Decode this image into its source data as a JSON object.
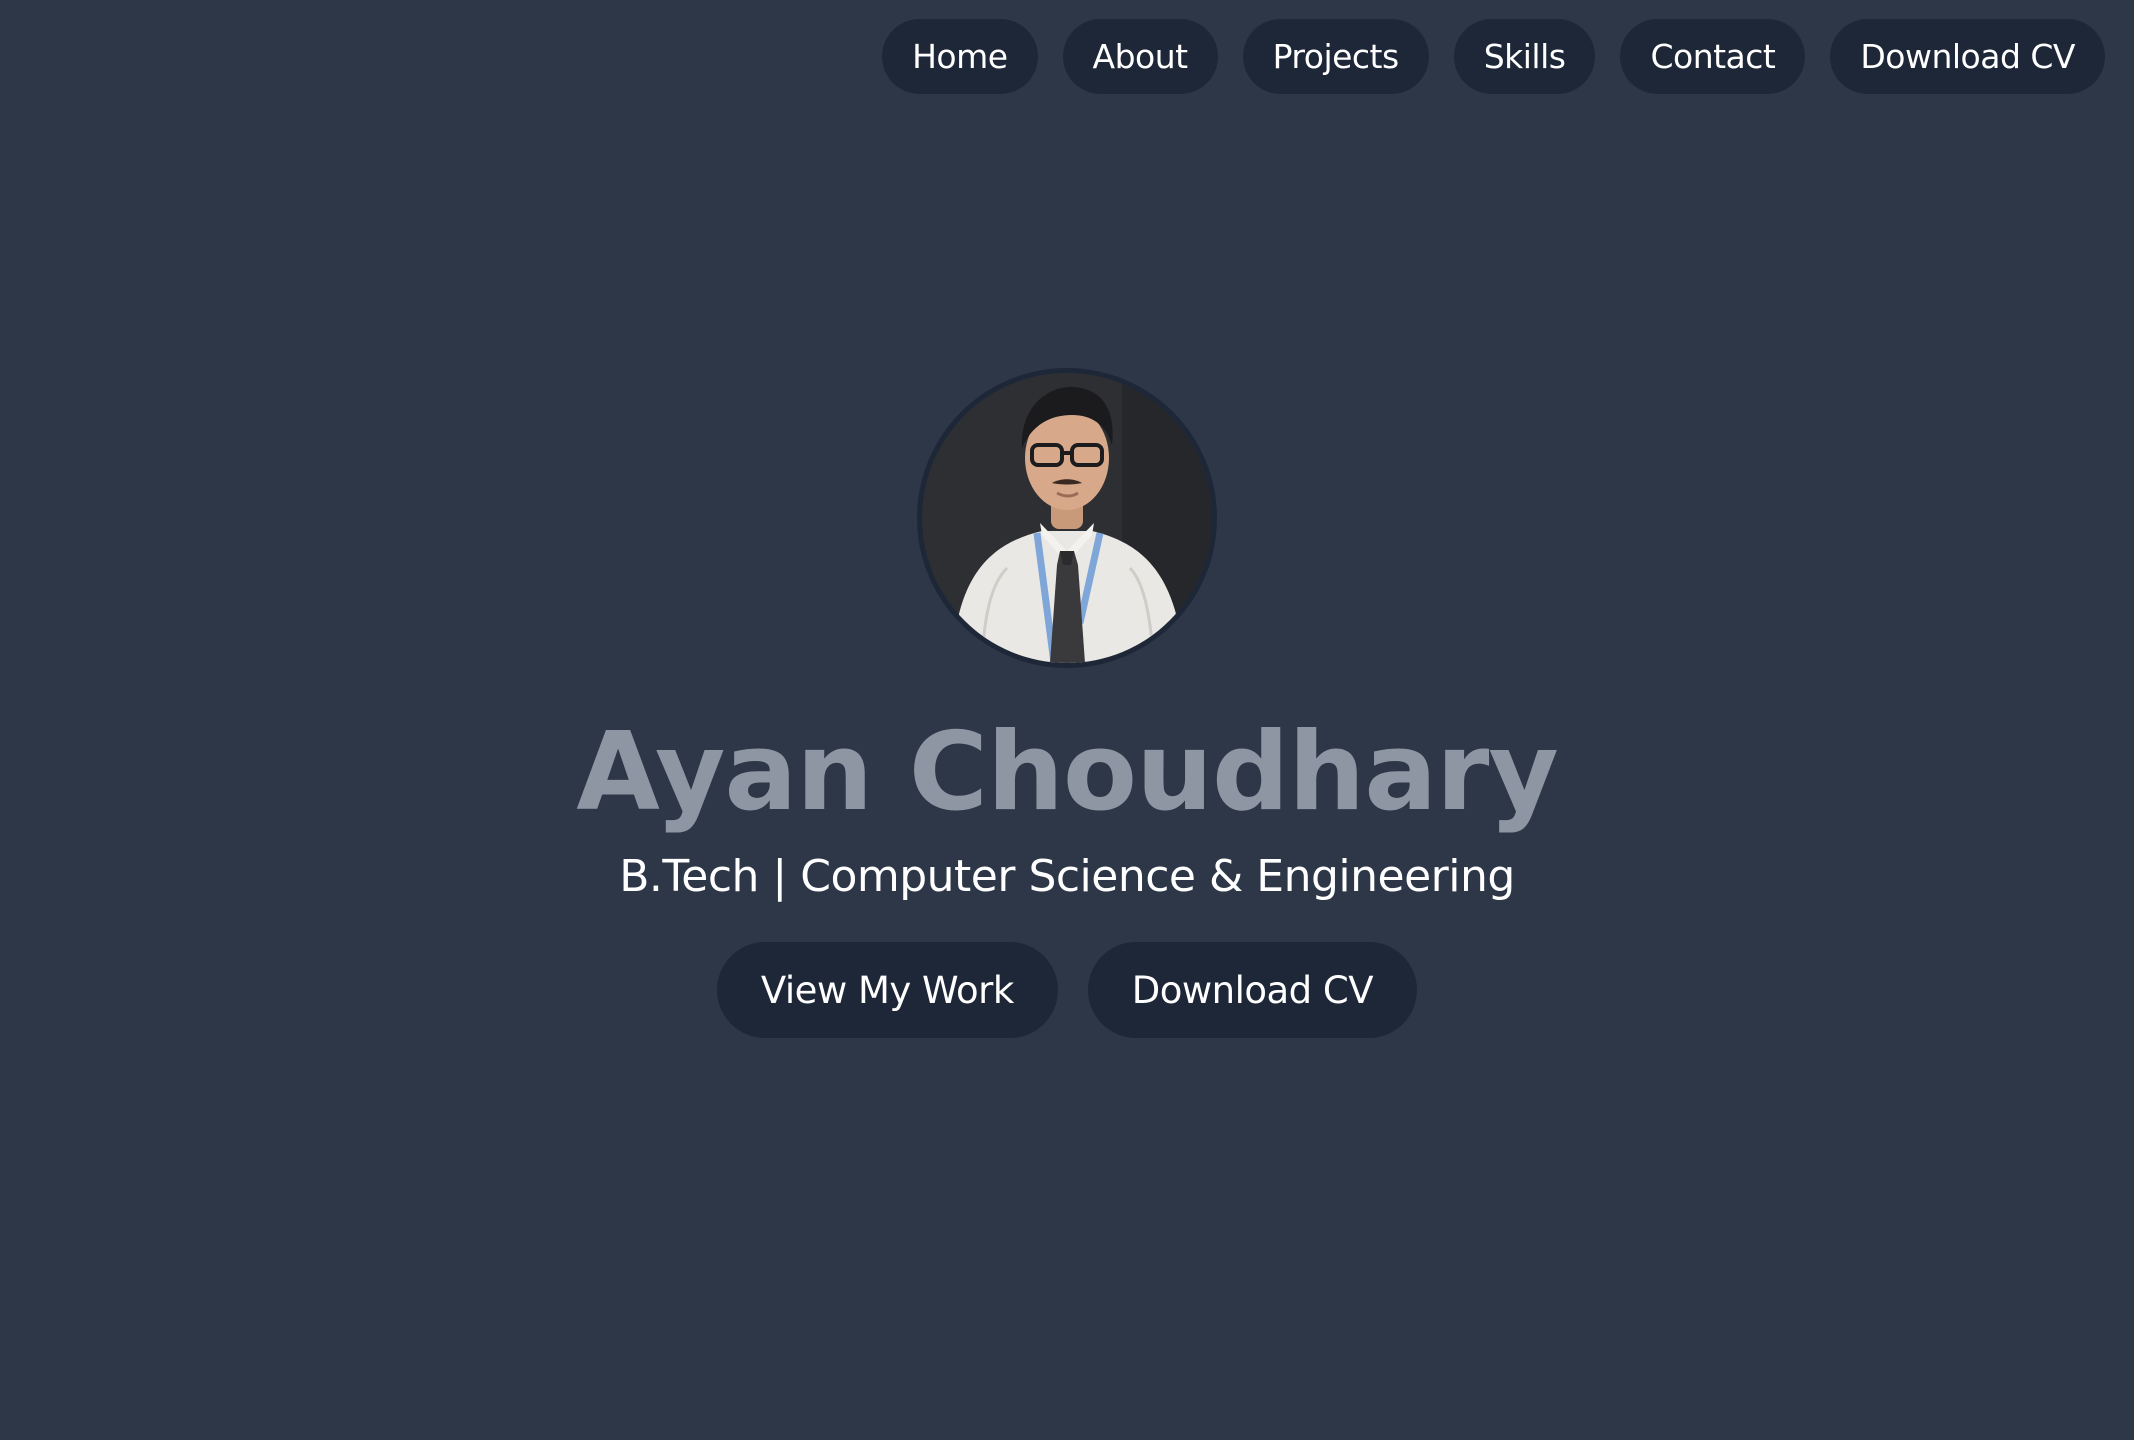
{
  "nav": {
    "items": [
      {
        "label": "Home"
      },
      {
        "label": "About"
      },
      {
        "label": "Projects"
      },
      {
        "label": "Skills"
      },
      {
        "label": "Contact"
      },
      {
        "label": "Download CV"
      }
    ]
  },
  "hero": {
    "name": "Ayan Choudhary",
    "subtitle": "B.Tech | Computer Science & Engineering",
    "buttons": {
      "view_work": "View My Work",
      "download_cv": "Download CV"
    }
  },
  "colors": {
    "background": "#2e3748",
    "pill": "#1e2738",
    "name_text": "#8f96a3",
    "text": "#ffffff"
  }
}
